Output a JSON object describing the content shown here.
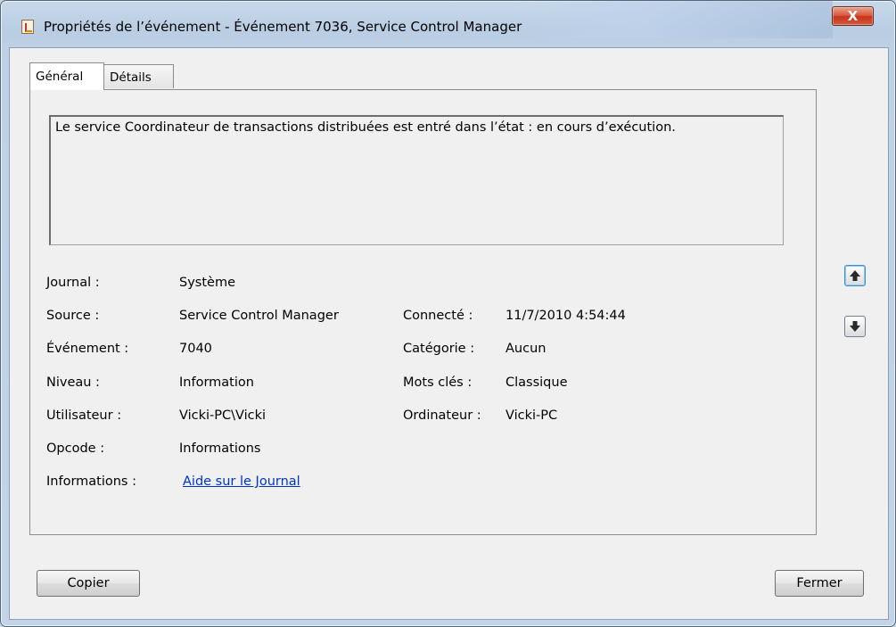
{
  "window": {
    "title": "Propriétés de l’événement - Événement 7036, Service Control Manager",
    "close_label": "X"
  },
  "tabs": [
    {
      "label": "Général",
      "active": true
    },
    {
      "label": "Détails",
      "active": false
    }
  ],
  "message": "Le service Coordinateur de transactions distribuées est entré dans l’état : en cours d’exécution.",
  "fields": {
    "journal": {
      "label": "Journal :",
      "value": "Système"
    },
    "source": {
      "label": "Source :",
      "value": "Service Control Manager"
    },
    "evenement": {
      "label": "Événement :",
      "value": "7040"
    },
    "niveau": {
      "label": "Niveau :",
      "value": "Information"
    },
    "utilisateur": {
      "label": "Utilisateur :",
      "value": "Vicki-PC\\Vicki"
    },
    "opcode": {
      "label": "Opcode :",
      "value": "Informations"
    },
    "informations": {
      "label": "Informations :",
      "value": "Aide sur le Journal"
    },
    "connecte": {
      "label": "Connecté :",
      "value": "11/7/2010 4:54:44"
    },
    "categorie": {
      "label": "Catégorie :",
      "value": "Aucun"
    },
    "mots_cles": {
      "label": "Mots clés :",
      "value": "Classique"
    },
    "ordinateur": {
      "label": "Ordinateur :",
      "value": "Vicki-PC"
    }
  },
  "buttons": {
    "copy": "Copier",
    "close": "Fermer"
  },
  "icons": {
    "app": "event-viewer-icon",
    "up": "arrow-up-icon",
    "down": "arrow-down-icon"
  }
}
